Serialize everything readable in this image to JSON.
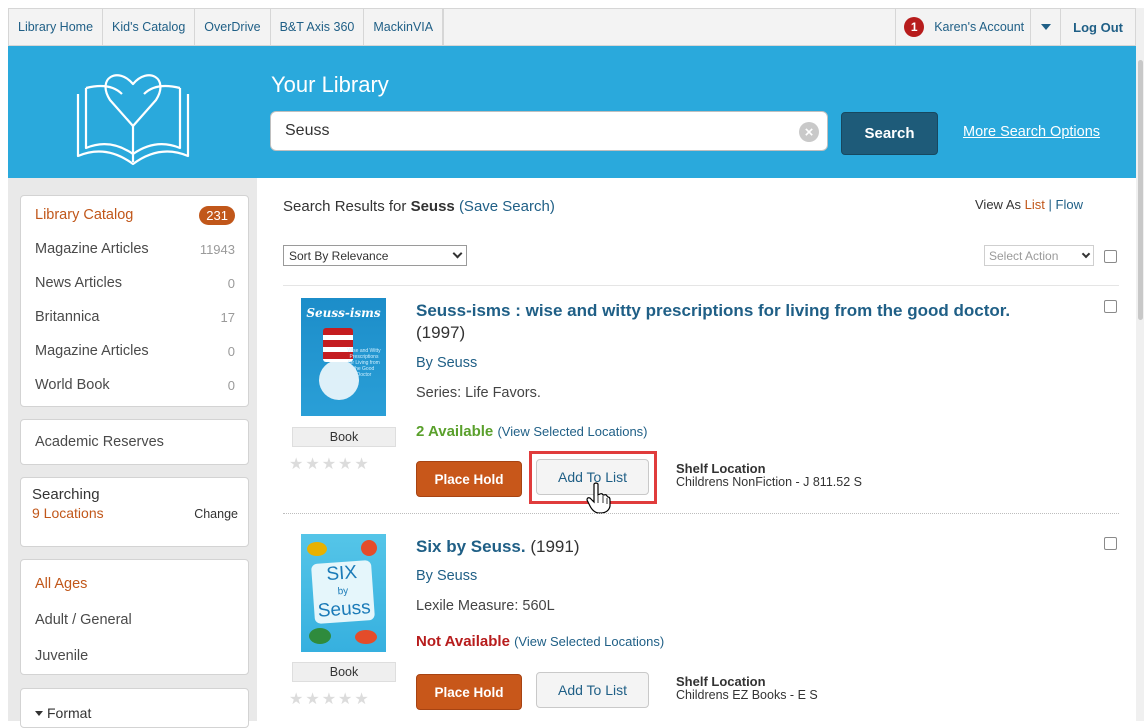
{
  "topnav": {
    "links": [
      "Library Home",
      "Kid's Catalog",
      "OverDrive",
      "B&T Axis 360",
      "MackinVIA"
    ],
    "notification_count": "1",
    "account": "Karen's Account",
    "logout": "Log Out"
  },
  "banner": {
    "title": "Your Library",
    "search_value": "Seuss",
    "search_button": "Search",
    "more_options": "More Search Options",
    "clear_icon": "×"
  },
  "sidebar": {
    "catalogs": [
      {
        "label": "Library Catalog",
        "count": "231"
      },
      {
        "label": "Magazine Articles",
        "count": "11943"
      },
      {
        "label": "News Articles",
        "count": "0"
      },
      {
        "label": "Britannica",
        "count": "17"
      },
      {
        "label": "Magazine Articles",
        "count": "0"
      },
      {
        "label": "World Book",
        "count": "0"
      }
    ],
    "academic": "Academic Reserves",
    "searching_label": "Searching",
    "locations": "9 Locations",
    "change": "Change",
    "ages": [
      "All Ages",
      "Adult / General",
      "Juvenile"
    ],
    "format": "Format"
  },
  "results": {
    "prefix": "Search Results for",
    "term": "Seuss",
    "save": "(Save Search)",
    "view_as": "View As",
    "view_list": "List",
    "view_sep": "|",
    "view_flow": "Flow",
    "sort": "Sort By Relevance",
    "select_action": "Select Action"
  },
  "items": [
    {
      "title": "Seuss-isms : wise and witty prescriptions for living from the good doctor.",
      "year": "(1997)",
      "author": "By Seuss",
      "meta": "Series: Life Favors.",
      "availability": "2 Available",
      "availability_color": "#5aa02c",
      "view_locations": "(View Selected Locations)",
      "format": "Book",
      "hold": "Place Hold",
      "add_list": "Add To List",
      "shelf_label": "Shelf Location",
      "shelf_value": "Childrens NonFiction - J 811.52 S",
      "cover_title": "Seuss-isms",
      "cover_blurb": "Wise and Witty Prescriptions for Living from the Good Doctor"
    },
    {
      "title": "Six by Seuss.",
      "year": "(1991)",
      "author": "By Seuss",
      "meta": "Lexile Measure: 560L",
      "availability": "Not Available",
      "availability_color": "#b71c1c",
      "view_locations": "(View Selected Locations)",
      "format": "Book",
      "hold": "Place Hold",
      "add_list": "Add To List",
      "shelf_label": "Shelf Location",
      "shelf_value": "Childrens EZ Books - E S",
      "cover_title_a": "SIX",
      "cover_title_b": "by",
      "cover_title_c": "Seuss"
    }
  ],
  "stars_glyph": "★★★★★",
  "colors": {
    "accent": "#c1571a",
    "banner": "#2aa9dc",
    "link": "#1f5f86",
    "highlight": "#e03c3c"
  }
}
